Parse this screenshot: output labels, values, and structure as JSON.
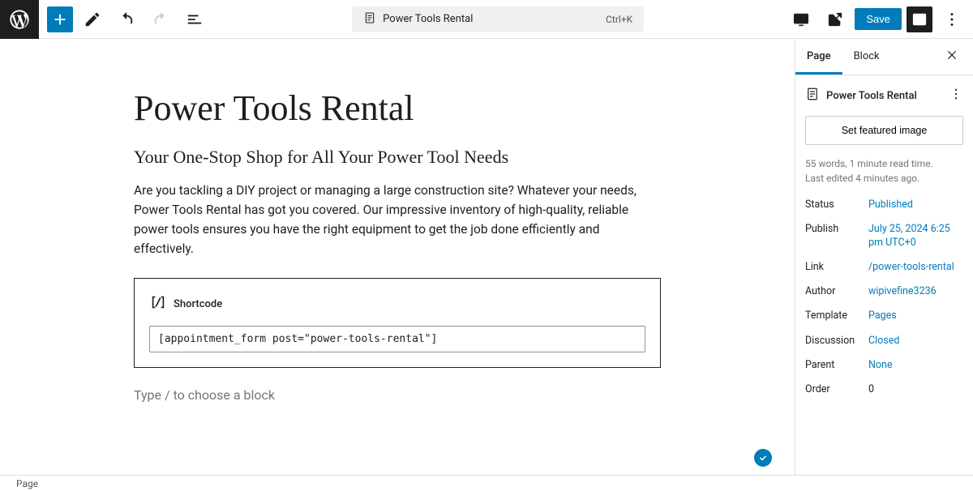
{
  "topbar": {
    "doc_title": "Power Tools Rental",
    "shortcut": "Ctrl+K",
    "save_label": "Save"
  },
  "canvas": {
    "title": "Power Tools Rental",
    "subtitle": "Your One-Stop Shop for All Your Power Tool Needs",
    "paragraph": "Are you tackling a DIY project or managing a large construction site? Whatever your needs, Power Tools Rental has got you covered. Our impressive inventory of high-quality, reliable power tools ensures you have the right equipment to get the job done efficiently and effectively.",
    "shortcode_label": "Shortcode",
    "shortcode_value": "[appointment_form post=\"power-tools-rental\"]",
    "block_prompt": "Type / to choose a block"
  },
  "sidebar": {
    "tabs": {
      "page": "Page",
      "block": "Block"
    },
    "doc_title": "Power Tools Rental",
    "featured_image_label": "Set featured image",
    "word_count": "55 words, 1 minute read time.",
    "last_edited": "Last edited 4 minutes ago.",
    "rows": {
      "status": {
        "label": "Status",
        "value": "Published"
      },
      "publish": {
        "label": "Publish",
        "value": "July 25, 2024 6:25 pm UTC+0"
      },
      "link": {
        "label": "Link",
        "value": "/power-tools-rental"
      },
      "author": {
        "label": "Author",
        "value": "wipivefine3236"
      },
      "template": {
        "label": "Template",
        "value": "Pages"
      },
      "discussion": {
        "label": "Discussion",
        "value": "Closed"
      },
      "parent": {
        "label": "Parent",
        "value": "None"
      },
      "order": {
        "label": "Order",
        "value": "0"
      }
    }
  },
  "footer": {
    "breadcrumb": "Page"
  }
}
